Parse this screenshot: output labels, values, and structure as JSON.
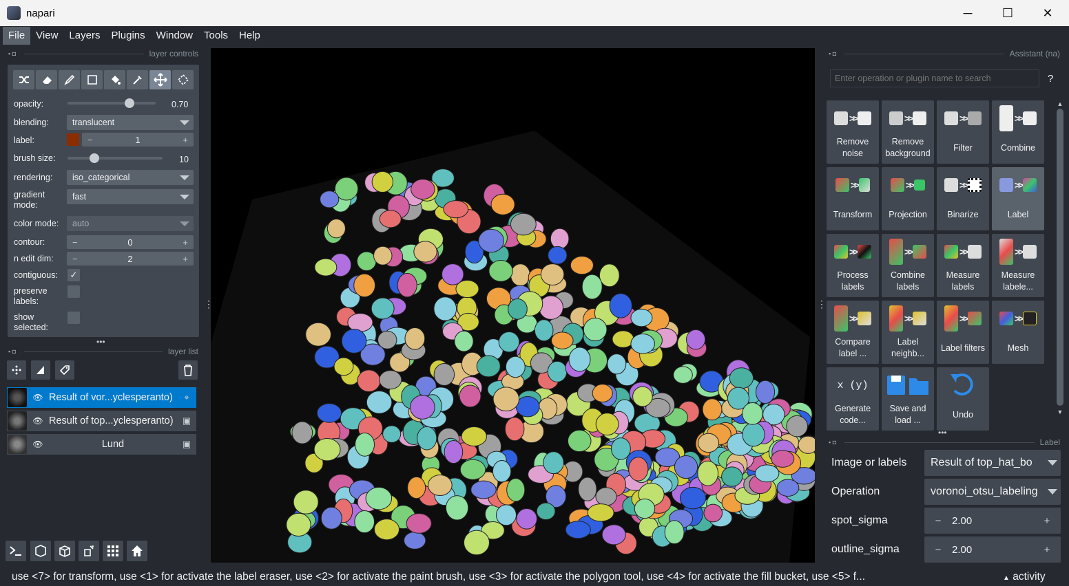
{
  "window": {
    "title": "napari",
    "minimize": "─",
    "maximize": "☐",
    "close": "✕"
  },
  "menu": [
    "File",
    "View",
    "Layers",
    "Plugins",
    "Window",
    "Tools",
    "Help"
  ],
  "layer_controls": {
    "title": "layer controls",
    "opacity_label": "opacity:",
    "opacity_value": "0.70",
    "opacity_level": 0.7,
    "blending_label": "blending:",
    "blending_value": "translucent",
    "label_label": "label:",
    "label_value": "1",
    "label_color": "#8b2d00",
    "brush_label": "brush size:",
    "brush_value": "10",
    "brush_level": 0.28,
    "rendering_label": "rendering:",
    "rendering_value": "iso_categorical",
    "gradient_label": "gradient mode:",
    "gradient_value": "fast",
    "colormode_label": "color mode:",
    "colormode_value": "auto",
    "contour_label": "contour:",
    "contour_value": "0",
    "nedit_label": "n edit dim:",
    "nedit_value": "2",
    "contiguous_label": "contiguous:",
    "contiguous_checked": true,
    "preserve_label": "preserve labels:",
    "preserve_checked": false,
    "showsel_label": "show selected:",
    "showsel_checked": false,
    "tools": [
      "shuffle-icon",
      "eraser-icon",
      "brush-icon",
      "polygon-icon",
      "fill-icon",
      "picker-icon",
      "pan-icon",
      "transform-icon"
    ]
  },
  "layer_list": {
    "title": "layer list",
    "layers": [
      {
        "name": "Result of vor...yclesperanto)",
        "type": "labels",
        "selected": true
      },
      {
        "name": "Result of top...yclesperanto)",
        "type": "image",
        "selected": false
      },
      {
        "name": "Lund",
        "type": "image",
        "selected": false
      }
    ]
  },
  "assistant": {
    "title": "Assistant (na)",
    "search_placeholder": "Enter operation or plugin name to search",
    "help": "?",
    "tiles": [
      {
        "label": "Remove noise"
      },
      {
        "label": "Remove background"
      },
      {
        "label": "Filter"
      },
      {
        "label": "Combine"
      },
      {
        "label": "Transform"
      },
      {
        "label": "Projection"
      },
      {
        "label": "Binarize"
      },
      {
        "label": "Label"
      },
      {
        "label": "Process labels"
      },
      {
        "label": "Combine labels"
      },
      {
        "label": "Measure labels"
      },
      {
        "label": "Measure labele..."
      },
      {
        "label": "Compare label ..."
      },
      {
        "label": "Label neighb..."
      },
      {
        "label": "Label filters"
      },
      {
        "label": "Mesh"
      },
      {
        "label": "Generate code..."
      },
      {
        "label": "Save and load ..."
      },
      {
        "label": "Undo"
      }
    ],
    "xy_glyph": "x (y)"
  },
  "label_panel": {
    "title": "Label",
    "image_label": "Image or labels",
    "image_value": "Result of top_hat_bo",
    "op_label": "Operation",
    "op_value": "voronoi_otsu_labeling",
    "spot_label": "spot_sigma",
    "spot_value": "2.00",
    "outline_label": "outline_sigma",
    "outline_value": "2.00"
  },
  "status": {
    "text": "use <7> for transform, use <1> for activate the label eraser, use <2> for activate the paint brush, use <3> for activate the polygon tool, use <4> for activate the fill bucket, use <5> f...",
    "activity": "activity"
  },
  "colors": {
    "accent": "#007acc",
    "bg": "#262930",
    "panel": "#414851",
    "control": "#5a626c"
  }
}
